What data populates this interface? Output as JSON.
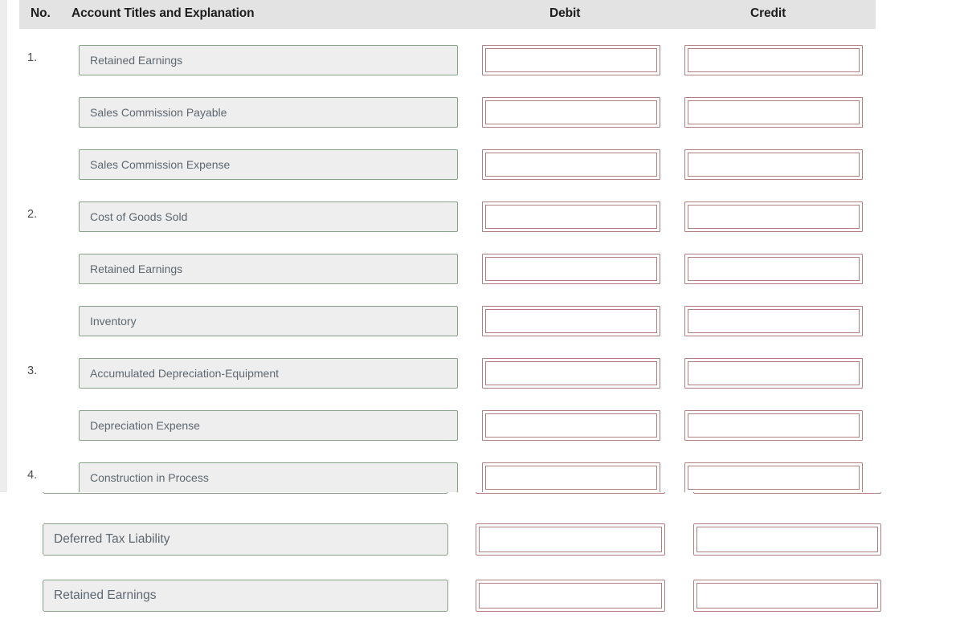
{
  "table": {
    "columns": {
      "no": "No.",
      "account": "Account Titles and Explanation",
      "debit": "Debit",
      "credit": "Credit"
    },
    "header_background": "#e3e3e3",
    "account_box_border": "#86a185",
    "account_box_background": "#eeeeee",
    "amount_box_border": "#b08080",
    "placeholder_color": "#5d6770",
    "rows": [
      {
        "no": "1.",
        "account_placeholder": "Retained Earnings",
        "debit": "",
        "credit": ""
      },
      {
        "no": "",
        "account_placeholder": "Sales Commission Payable",
        "debit": "",
        "credit": ""
      },
      {
        "no": "",
        "account_placeholder": "Sales Commission Expense",
        "debit": "",
        "credit": ""
      },
      {
        "no": "2.",
        "account_placeholder": "Cost of Goods Sold",
        "debit": "",
        "credit": ""
      },
      {
        "no": "",
        "account_placeholder": "Retained Earnings",
        "debit": "",
        "credit": ""
      },
      {
        "no": "",
        "account_placeholder": "Inventory",
        "debit": "",
        "credit": ""
      },
      {
        "no": "3.",
        "account_placeholder": "Accumulated Depreciation-Equipment",
        "debit": "",
        "credit": ""
      },
      {
        "no": "",
        "account_placeholder": "Depreciation Expense",
        "debit": "",
        "credit": ""
      },
      {
        "no": "4.",
        "account_placeholder": "Construction in Process",
        "debit": "",
        "credit": ""
      }
    ]
  },
  "overlay": {
    "rows": [
      {
        "account_placeholder": "Deferred Tax Liability",
        "debit": "",
        "credit": ""
      },
      {
        "account_placeholder": "Retained Earnings",
        "debit": "",
        "credit": ""
      }
    ]
  }
}
